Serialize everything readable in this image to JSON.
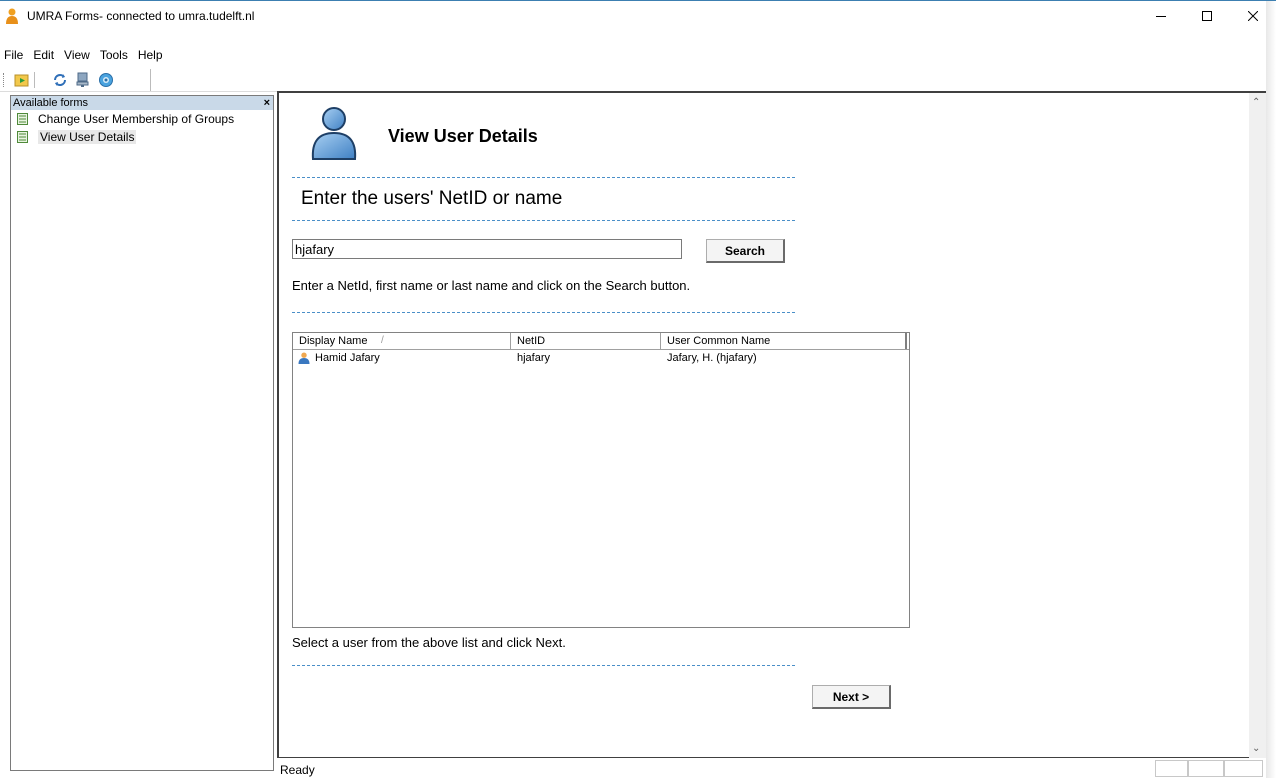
{
  "window": {
    "title": "UMRA Forms- connected to umra.tudelft.nl",
    "controls": [
      "minimize",
      "maximize",
      "close"
    ]
  },
  "menu": [
    "File",
    "Edit",
    "View",
    "Tools",
    "Help"
  ],
  "toolbar": {
    "buttons": [
      "open-form-icon",
      "refresh-icon",
      "connect-icon",
      "settings-icon"
    ]
  },
  "left_pane": {
    "header": "Available forms",
    "close": "×",
    "items": [
      {
        "label": "Change User Membership of Groups",
        "selected": false
      },
      {
        "label": "View User Details",
        "selected": true
      }
    ]
  },
  "form": {
    "title": "View User Details",
    "heading": "Enter the users' NetID or name",
    "search": {
      "value": "hjafary",
      "button": "Search"
    },
    "hint": "Enter a NetId, first name or last name and click on the Search button.",
    "list": {
      "columns": [
        "Display Name",
        "NetID",
        "User Common Name"
      ],
      "sort_indicator": "/",
      "rows": [
        {
          "display_name": "Hamid Jafary",
          "netid": "hjafary",
          "common_name": "Jafary, H. (hjafary)"
        }
      ]
    },
    "select_hint": "Select a user from the above list and click Next.",
    "next_button": "Next >"
  },
  "status": {
    "text": "Ready"
  },
  "colors": {
    "accent_dash": "#4a8fc8",
    "pane_header": "#c9d9e8",
    "selection": "#3399ff"
  }
}
